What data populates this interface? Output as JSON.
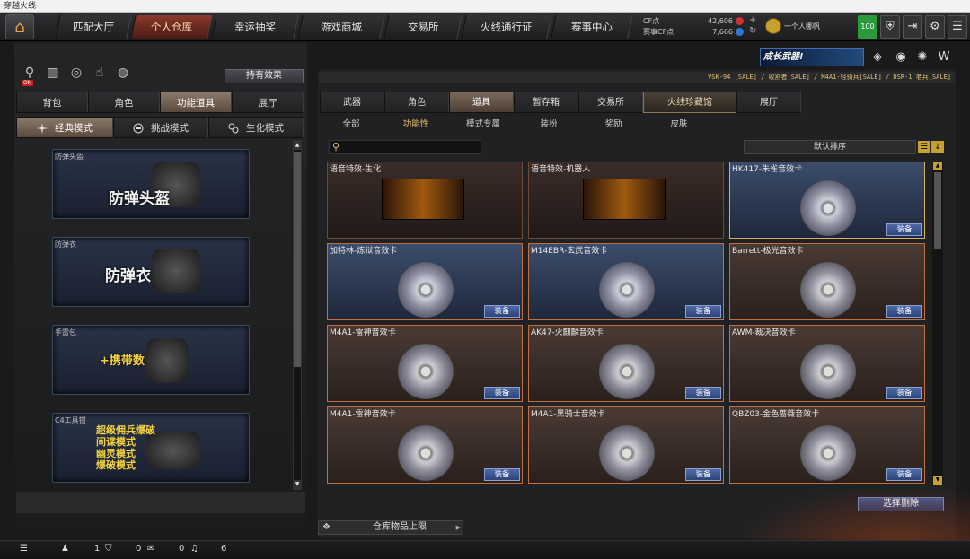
{
  "window_title": "穿越火线",
  "nav": {
    "tabs": [
      {
        "label": "匹配大厅"
      },
      {
        "label": "个人仓库"
      },
      {
        "label": "幸运抽奖"
      },
      {
        "label": "游戏商城"
      },
      {
        "label": "交易所"
      },
      {
        "label": "火线通行证"
      },
      {
        "label": "赛事中心"
      }
    ],
    "active": 1
  },
  "currency": {
    "cf_label": "CF点",
    "cf_value": "42,606",
    "sm_label": "赛事CF点",
    "sm_value": "7,666"
  },
  "user": {
    "name": "一个人哪帆",
    "level": "100"
  },
  "left": {
    "hold_effect": "持有效果",
    "on_badge": "ON",
    "tabs": [
      {
        "label": "背包"
      },
      {
        "label": "角色"
      },
      {
        "label": "功能道具"
      },
      {
        "label": "展厅"
      }
    ],
    "modes": [
      {
        "label": "经典模式"
      },
      {
        "label": "挑战模式"
      },
      {
        "label": "生化模式"
      }
    ],
    "items": [
      {
        "label": "防弹头盔",
        "big": "防弹头盔"
      },
      {
        "label": "防弹衣",
        "big": "防弹衣"
      },
      {
        "label": "手雷包",
        "big": "+携带数"
      },
      {
        "label": "C4工具钳",
        "multi": [
          "超级佣兵爆破",
          "间谍模式",
          "幽灵模式",
          "爆破模式"
        ]
      }
    ]
  },
  "marquee": "VSK-94 [SALE] / 收割者[SALE] / M4A1-轻骑兵[SALE] / DSR-1 老兵[SALE]",
  "banner": "成长武器!",
  "right": {
    "tabs": [
      {
        "label": "武器"
      },
      {
        "label": "角色"
      },
      {
        "label": "道具"
      },
      {
        "label": "暂存箱"
      },
      {
        "label": "交易所"
      },
      {
        "label": "火线珍藏馆"
      },
      {
        "label": "展厅"
      }
    ],
    "subtabs": [
      {
        "label": "全部"
      },
      {
        "label": "功能性"
      },
      {
        "label": "模式专属"
      },
      {
        "label": "装扮"
      },
      {
        "label": "奖励"
      },
      {
        "label": "皮肤"
      }
    ],
    "sort": "默认排序",
    "equip_label": "装备",
    "cards": [
      {
        "name": "语音特效-生化",
        "kind": "voice",
        "equip": false
      },
      {
        "name": "语音特效-机器人",
        "kind": "voice",
        "equip": false
      },
      {
        "name": "HK417-朱雀音效卡",
        "kind": "blue",
        "equip": true
      },
      {
        "name": "加特林-炼狱音效卡",
        "kind": "blue",
        "equip": true
      },
      {
        "name": "M14EBR-玄武音效卡",
        "kind": "blue",
        "equip": true
      },
      {
        "name": "Barrett-极光音效卡",
        "kind": "brown",
        "equip": true
      },
      {
        "name": "M4A1-雷神音效卡",
        "kind": "brown",
        "equip": true
      },
      {
        "name": "AK47-火麒麟音效卡",
        "kind": "brown",
        "equip": true
      },
      {
        "name": "AWM-裁决音效卡",
        "kind": "brown",
        "equip": true
      },
      {
        "name": "M4A1-雷神音效卡",
        "kind": "brown",
        "equip": true
      },
      {
        "name": "M4A1-黑骑士音效卡",
        "kind": "brown",
        "equip": true
      },
      {
        "name": "QBZ03-金色蔷薇音效卡",
        "kind": "brown",
        "equip": true
      }
    ],
    "select_delete": "选择删除",
    "limit": "仓库物品上限"
  },
  "status": {
    "a": "1",
    "b": "0",
    "c": "0",
    "d": "6"
  }
}
